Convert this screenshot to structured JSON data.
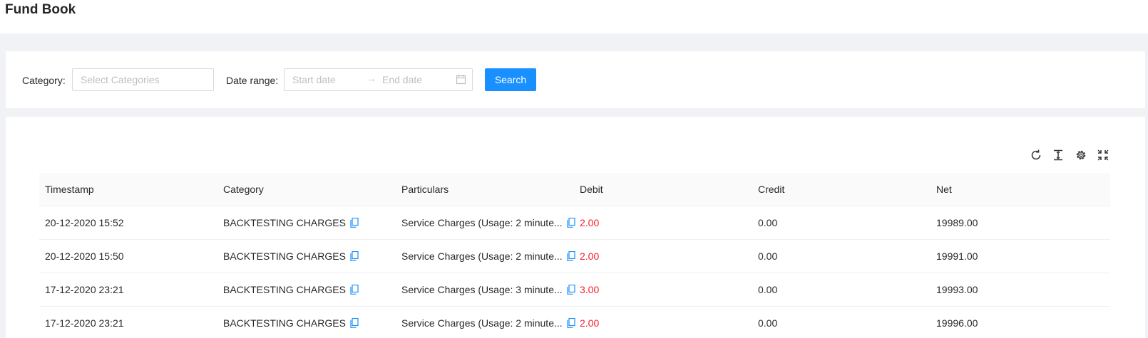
{
  "header": {
    "title": "Fund Book"
  },
  "filters": {
    "category_label": "Category",
    "category_placeholder": "Select Categories",
    "date_label": "Date range",
    "start_placeholder": "Start date",
    "end_placeholder": "End date",
    "arrow": "→",
    "search_label": "Search"
  },
  "toolbar": {
    "icons": [
      "reload-icon",
      "density-icon",
      "settings-icon",
      "fullscreen-icon"
    ]
  },
  "table": {
    "columns": [
      "Timestamp",
      "Category",
      "Particulars",
      "Debit",
      "Credit",
      "Net"
    ],
    "rows": [
      {
        "timestamp": "20-12-2020 15:52",
        "category": "BACKTESTING CHARGES",
        "particulars": "Service Charges (Usage: 2 minute...",
        "debit": "2.00",
        "credit": "0.00",
        "net": "19989.00"
      },
      {
        "timestamp": "20-12-2020 15:50",
        "category": "BACKTESTING CHARGES",
        "particulars": "Service Charges (Usage: 2 minute...",
        "debit": "2.00",
        "credit": "0.00",
        "net": "19991.00"
      },
      {
        "timestamp": "17-12-2020 23:21",
        "category": "BACKTESTING CHARGES",
        "particulars": "Service Charges (Usage: 3 minute...",
        "debit": "3.00",
        "credit": "0.00",
        "net": "19993.00"
      },
      {
        "timestamp": "17-12-2020 23:21",
        "category": "BACKTESTING CHARGES",
        "particulars": "Service Charges (Usage: 2 minute...",
        "debit": "2.00",
        "credit": "0.00",
        "net": "19996.00"
      }
    ]
  },
  "colors": {
    "primary": "#1890ff",
    "debit": "#f5222d",
    "background": "#f0f2f5"
  }
}
